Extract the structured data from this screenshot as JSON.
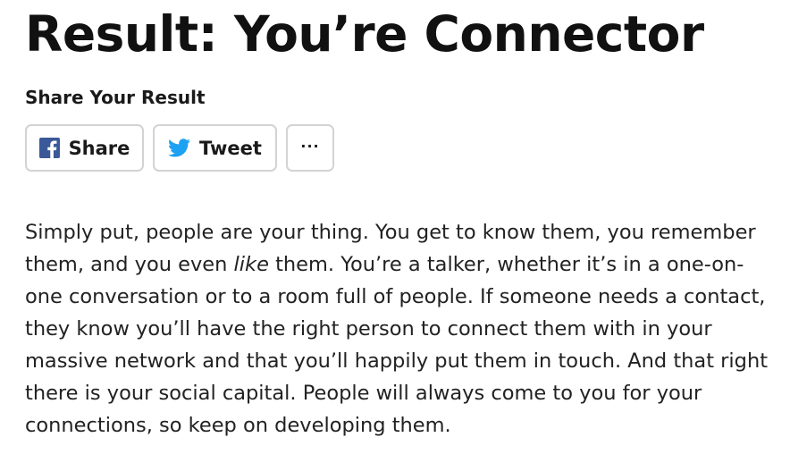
{
  "result": {
    "title": "Result: You’re Connector"
  },
  "share": {
    "heading": "Share Your Result",
    "facebook_label": "Share",
    "twitter_label": "Tweet",
    "more_label": "···",
    "facebook_color": "#3b5998",
    "twitter_color": "#1da1f2",
    "facebook_icon": "facebook-icon",
    "twitter_icon": "twitter-bird-icon"
  },
  "description": {
    "part1": "Simply put, people are your thing. You get to know them, you remember them, and you even ",
    "emphasis": "like",
    "part2": " them. You’re a talker, whether it’s in a one-on-one conversation or to a room full of people. If someone needs a contact, they know you’ll have the right person to connect them with in your massive network and that you’ll happily put them in touch. And that right there is your social capital. People will always come to you for your connections, so keep on developing them."
  }
}
